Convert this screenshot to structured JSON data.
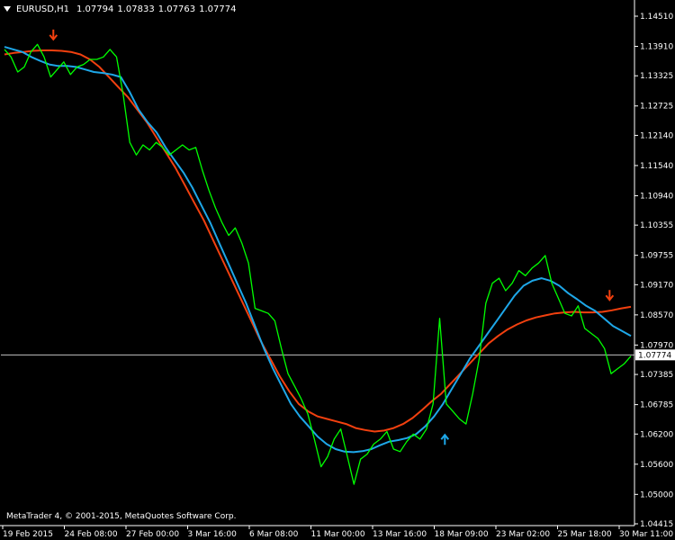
{
  "header": {
    "symbol": "EURUSD,H1",
    "open": "1.07794",
    "high": "1.07833",
    "low": "1.07763",
    "close": "1.07774"
  },
  "footer": {
    "copyright": "MetaTrader 4, © 2001-2015, MetaQuotes Software Corp."
  },
  "price_axis": {
    "ticks": [
      "1.14510",
      "1.13910",
      "1.13325",
      "1.12725",
      "1.12140",
      "1.11540",
      "1.10940",
      "1.10355",
      "1.09755",
      "1.09170",
      "1.08570",
      "1.07970",
      "1.07385",
      "1.06785",
      "1.06200",
      "1.05600",
      "1.05000",
      "1.04415"
    ],
    "current_price": "1.07774"
  },
  "time_axis": {
    "labels": [
      "19 Feb 2015",
      "24 Feb 08:00",
      "27 Feb 00:00",
      "3 Mar 16:00",
      "6 Mar 08:00",
      "11 Mar 00:00",
      "13 Mar 16:00",
      "18 Mar 09:00",
      "23 Mar 02:00",
      "25 Mar 18:00",
      "30 Mar 11:00"
    ]
  },
  "colors": {
    "background": "#000000",
    "price_line": "#00FF00",
    "fast_ma": "#1EA7E8",
    "slow_ma": "#F2400F",
    "sell_arrow": "#F2400F",
    "buy_arrow": "#1EA7E8",
    "axis": "#FFFFFF",
    "current_price_line": "#C0C0C0"
  },
  "chart_data": {
    "type": "line",
    "title": "EURUSD,H1",
    "x_labels": [
      "19 Feb 2015",
      "24 Feb 08:00",
      "27 Feb 00:00",
      "3 Mar 16:00",
      "6 Mar 08:00",
      "11 Mar 00:00",
      "13 Mar 16:00",
      "18 Mar 09:00",
      "23 Mar 02:00",
      "25 Mar 18:00",
      "30 Mar 11:00"
    ],
    "ylim": [
      1.04415,
      1.1451
    ],
    "series": [
      {
        "name": "",
        "style": "price",
        "values": [
          1.1385,
          1.137,
          1.134,
          1.135,
          1.138,
          1.1395,
          1.137,
          1.133,
          1.1345,
          1.136,
          1.1335,
          1.135,
          1.1355,
          1.1365,
          1.1365,
          1.137,
          1.1385,
          1.137,
          1.1295,
          1.12,
          1.1175,
          1.1195,
          1.1185,
          1.12,
          1.119,
          1.1175,
          1.1185,
          1.1195,
          1.1185,
          1.119,
          1.1145,
          1.1105,
          1.107,
          1.104,
          1.1015,
          1.103,
          1.1,
          1.096,
          1.087,
          1.0865,
          1.086,
          1.0845,
          1.079,
          1.074,
          1.0715,
          1.069,
          1.066,
          1.061,
          1.0555,
          1.0575,
          1.061,
          1.063,
          1.0575,
          1.052,
          1.057,
          1.058,
          1.06,
          1.061,
          1.0625,
          1.059,
          1.0585,
          1.0605,
          1.062,
          1.061,
          1.063,
          1.068,
          1.085,
          1.068,
          1.0665,
          1.065,
          1.064,
          1.07,
          1.077,
          1.088,
          1.092,
          1.093,
          1.0905,
          1.092,
          1.0945,
          1.0935,
          1.095,
          1.096,
          1.0975,
          1.092,
          1.089,
          1.086,
          1.0855,
          1.0875,
          1.083,
          1.082,
          1.081,
          1.079,
          1.074,
          1.075,
          1.076,
          1.0775
        ]
      },
      {
        "name": "",
        "style": "fast-ma",
        "values": [
          1.139,
          1.1385,
          1.138,
          1.137,
          1.1362,
          1.1355,
          1.1352,
          1.1352,
          1.135,
          1.1345,
          1.134,
          1.1338,
          1.1335,
          1.133,
          1.13,
          1.1265,
          1.124,
          1.122,
          1.119,
          1.1165,
          1.114,
          1.111,
          1.1075,
          1.104,
          1.1,
          1.096,
          1.092,
          1.088,
          1.0835,
          1.079,
          1.075,
          1.0715,
          1.068,
          1.0655,
          1.0635,
          1.0615,
          1.06,
          1.059,
          1.0585,
          1.0584,
          1.0586,
          1.059,
          1.0598,
          1.0605,
          1.0608,
          1.0612,
          1.062,
          1.0635,
          1.0655,
          1.068,
          1.071,
          1.074,
          1.077,
          1.0795,
          1.082,
          1.0845,
          1.087,
          1.0895,
          1.0915,
          1.0925,
          1.093,
          1.0925,
          1.0915,
          1.09,
          1.0888,
          1.0875,
          1.0865,
          1.085,
          1.0835,
          1.0825,
          1.0815
        ]
      },
      {
        "name": "",
        "style": "slow-ma",
        "values": [
          1.1375,
          1.1378,
          1.138,
          1.1382,
          1.1383,
          1.1383,
          1.1382,
          1.138,
          1.1375,
          1.1365,
          1.135,
          1.133,
          1.131,
          1.129,
          1.1265,
          1.124,
          1.121,
          1.118,
          1.115,
          1.1115,
          1.108,
          1.1045,
          1.1005,
          1.0965,
          1.0925,
          1.0885,
          1.0845,
          1.0805,
          1.077,
          1.0735,
          1.0705,
          1.068,
          1.0665,
          1.0655,
          1.065,
          1.0645,
          1.064,
          1.0632,
          1.0628,
          1.0625,
          1.0627,
          1.0632,
          1.064,
          1.0652,
          1.0668,
          1.0685,
          1.07,
          1.072,
          1.074,
          1.076,
          1.078,
          1.08,
          1.0815,
          1.0828,
          1.0838,
          1.0846,
          1.0852,
          1.0856,
          1.086,
          1.0862,
          1.0863,
          1.0862,
          1.0862,
          1.0863,
          1.0866,
          1.087,
          1.0873
        ]
      }
    ],
    "signals": [
      {
        "type": "sell",
        "x_frac": 0.078,
        "price": 1.1403
      },
      {
        "type": "buy",
        "x_frac": 0.703,
        "price": 1.062
      },
      {
        "type": "sell",
        "x_frac": 0.966,
        "price": 1.0885
      }
    ]
  }
}
